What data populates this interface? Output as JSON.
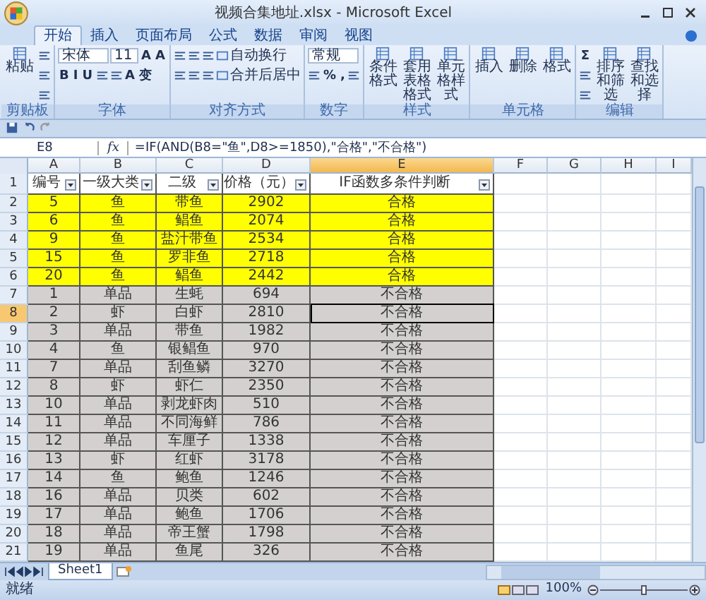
{
  "window": {
    "title": "视频合集地址.xlsx - Microsoft Excel"
  },
  "tabs": [
    {
      "label": "开始",
      "selected": true
    },
    {
      "label": "插入",
      "selected": false
    },
    {
      "label": "页面布局",
      "selected": false
    },
    {
      "label": "公式",
      "selected": false
    },
    {
      "label": "数据",
      "selected": false
    },
    {
      "label": "审阅",
      "selected": false
    },
    {
      "label": "视图",
      "selected": false
    }
  ],
  "ribbon": {
    "groups": [
      {
        "label": "剪贴板",
        "large": [
          {
            "label": "粘贴"
          }
        ],
        "rows": [
          {
            "items": [
              {
                "kind": "icon"
              }
            ]
          },
          {
            "items": [
              {
                "kind": "icon"
              }
            ]
          },
          {
            "items": [
              {
                "kind": "icon"
              }
            ]
          }
        ]
      },
      {
        "label": "字体",
        "rows": [
          {
            "items": [
              {
                "kind": "field",
                "value": "宋体"
              },
              {
                "kind": "field",
                "value": "11"
              },
              {
                "kind": "glyph",
                "label": "A"
              },
              {
                "kind": "glyph",
                "label": "A"
              }
            ]
          },
          {
            "items": [
              {
                "kind": "glyph",
                "label": "B"
              },
              {
                "kind": "glyph",
                "label": "I"
              },
              {
                "kind": "glyph",
                "label": "U"
              },
              {
                "kind": "icon"
              },
              {
                "kind": "icon"
              },
              {
                "kind": "glyph",
                "label": "A"
              },
              {
                "kind": "glyph",
                "label": "变"
              }
            ]
          }
        ]
      },
      {
        "label": "对齐方式",
        "rows": [
          {
            "items": [
              {
                "kind": "icon"
              },
              {
                "kind": "icon"
              },
              {
                "kind": "icon"
              },
              {
                "kind": "small",
                "label": "自动换行"
              }
            ]
          },
          {
            "items": [
              {
                "kind": "icon"
              },
              {
                "kind": "icon"
              },
              {
                "kind": "icon"
              },
              {
                "kind": "small",
                "label": "合并后居中"
              }
            ]
          }
        ]
      },
      {
        "label": "数字",
        "rows": [
          {
            "items": [
              {
                "kind": "field",
                "value": "常规"
              }
            ]
          },
          {
            "items": [
              {
                "kind": "icon"
              },
              {
                "kind": "glyph",
                "label": "%"
              },
              {
                "kind": "glyph",
                "label": ","
              },
              {
                "kind": "icon"
              }
            ]
          }
        ]
      },
      {
        "label": "样式",
        "large": [
          {
            "label": "条件格式"
          },
          {
            "label": "套用表格格式"
          },
          {
            "label": "单元格样式"
          }
        ]
      },
      {
        "label": "单元格",
        "large": [
          {
            "label": "插入"
          },
          {
            "label": "删除"
          },
          {
            "label": "格式"
          }
        ]
      },
      {
        "label": "编辑",
        "rows": [
          {
            "items": [
              {
                "kind": "glyph",
                "label": "Σ"
              }
            ]
          },
          {
            "items": [
              {
                "kind": "icon"
              }
            ]
          },
          {
            "items": [
              {
                "kind": "icon"
              }
            ]
          }
        ],
        "large": [
          {
            "label": "排序和筛选"
          },
          {
            "label": "查找和选择"
          }
        ]
      }
    ]
  },
  "formula_bar": {
    "name_box": "E8",
    "fx": "fx",
    "formula": "=IF(AND(B8=\"鱼\",D8>=1850),\"合格\",\"不合格\")"
  },
  "columns": [
    {
      "letter": "A",
      "selected": false
    },
    {
      "letter": "B",
      "selected": false
    },
    {
      "letter": "C",
      "selected": false
    },
    {
      "letter": "D",
      "selected": false
    },
    {
      "letter": "E",
      "selected": true
    },
    {
      "letter": "F",
      "selected": false
    },
    {
      "letter": "G",
      "selected": false
    },
    {
      "letter": "H",
      "selected": false
    },
    {
      "letter": "I",
      "selected": false
    }
  ],
  "header_row": {
    "row_number": "1",
    "cells": [
      "编号",
      "一级大类",
      "二级",
      "价格（元）",
      "IF函数多条件判断"
    ]
  },
  "rows": [
    {
      "row_number": "2",
      "highlighted": true,
      "selected": false,
      "cells": [
        "5",
        "鱼",
        "带鱼",
        "2902",
        "合格"
      ]
    },
    {
      "row_number": "3",
      "highlighted": true,
      "selected": false,
      "cells": [
        "6",
        "鱼",
        "鲳鱼",
        "2074",
        "合格"
      ]
    },
    {
      "row_number": "4",
      "highlighted": true,
      "selected": false,
      "cells": [
        "9",
        "鱼",
        "盐汁带鱼",
        "2534",
        "合格"
      ]
    },
    {
      "row_number": "5",
      "highlighted": true,
      "selected": false,
      "cells": [
        "15",
        "鱼",
        "罗非鱼",
        "2718",
        "合格"
      ]
    },
    {
      "row_number": "6",
      "highlighted": true,
      "selected": false,
      "cells": [
        "20",
        "鱼",
        "鲳鱼",
        "2442",
        "合格"
      ]
    },
    {
      "row_number": "7",
      "highlighted": false,
      "selected": false,
      "cells": [
        "1",
        "单品",
        "生蚝",
        "694",
        "不合格"
      ]
    },
    {
      "row_number": "8",
      "highlighted": false,
      "selected": true,
      "cells": [
        "2",
        "虾",
        "白虾",
        "2810",
        "不合格"
      ]
    },
    {
      "row_number": "9",
      "highlighted": false,
      "selected": false,
      "cells": [
        "3",
        "单品",
        "带鱼",
        "1982",
        "不合格"
      ]
    },
    {
      "row_number": "10",
      "highlighted": false,
      "selected": false,
      "cells": [
        "4",
        "鱼",
        "银鲳鱼",
        "970",
        "不合格"
      ]
    },
    {
      "row_number": "11",
      "highlighted": false,
      "selected": false,
      "cells": [
        "7",
        "单品",
        "刮鱼鳞",
        "3270",
        "不合格"
      ]
    },
    {
      "row_number": "12",
      "highlighted": false,
      "selected": false,
      "cells": [
        "8",
        "虾",
        "虾仁",
        "2350",
        "不合格"
      ]
    },
    {
      "row_number": "13",
      "highlighted": false,
      "selected": false,
      "cells": [
        "10",
        "单品",
        "剥龙虾肉",
        "510",
        "不合格"
      ]
    },
    {
      "row_number": "14",
      "highlighted": false,
      "selected": false,
      "cells": [
        "11",
        "单品",
        "不同海鲜",
        "786",
        "不合格"
      ]
    },
    {
      "row_number": "15",
      "highlighted": false,
      "selected": false,
      "cells": [
        "12",
        "单品",
        "车厘子",
        "1338",
        "不合格"
      ]
    },
    {
      "row_number": "16",
      "highlighted": false,
      "selected": false,
      "cells": [
        "13",
        "虾",
        "红虾",
        "3178",
        "不合格"
      ]
    },
    {
      "row_number": "17",
      "highlighted": false,
      "selected": false,
      "cells": [
        "14",
        "鱼",
        "鲍鱼",
        "1246",
        "不合格"
      ]
    },
    {
      "row_number": "18",
      "highlighted": false,
      "selected": false,
      "cells": [
        "16",
        "单品",
        "贝类",
        "602",
        "不合格"
      ]
    },
    {
      "row_number": "19",
      "highlighted": false,
      "selected": false,
      "cells": [
        "17",
        "单品",
        "鲍鱼",
        "1706",
        "不合格"
      ]
    },
    {
      "row_number": "20",
      "highlighted": false,
      "selected": false,
      "cells": [
        "18",
        "单品",
        "帝王蟹",
        "1798",
        "不合格"
      ]
    },
    {
      "row_number": "21",
      "highlighted": false,
      "selected": false,
      "cells": [
        "19",
        "单品",
        "鱼尾",
        "326",
        "不合格"
      ]
    }
  ],
  "sheet_tabs": [
    {
      "label": "Sheet1",
      "selected": true
    }
  ],
  "status_bar": {
    "status": "就绪",
    "zoom": "100%",
    "zoom_slider": {
      "level": 0.5
    }
  }
}
